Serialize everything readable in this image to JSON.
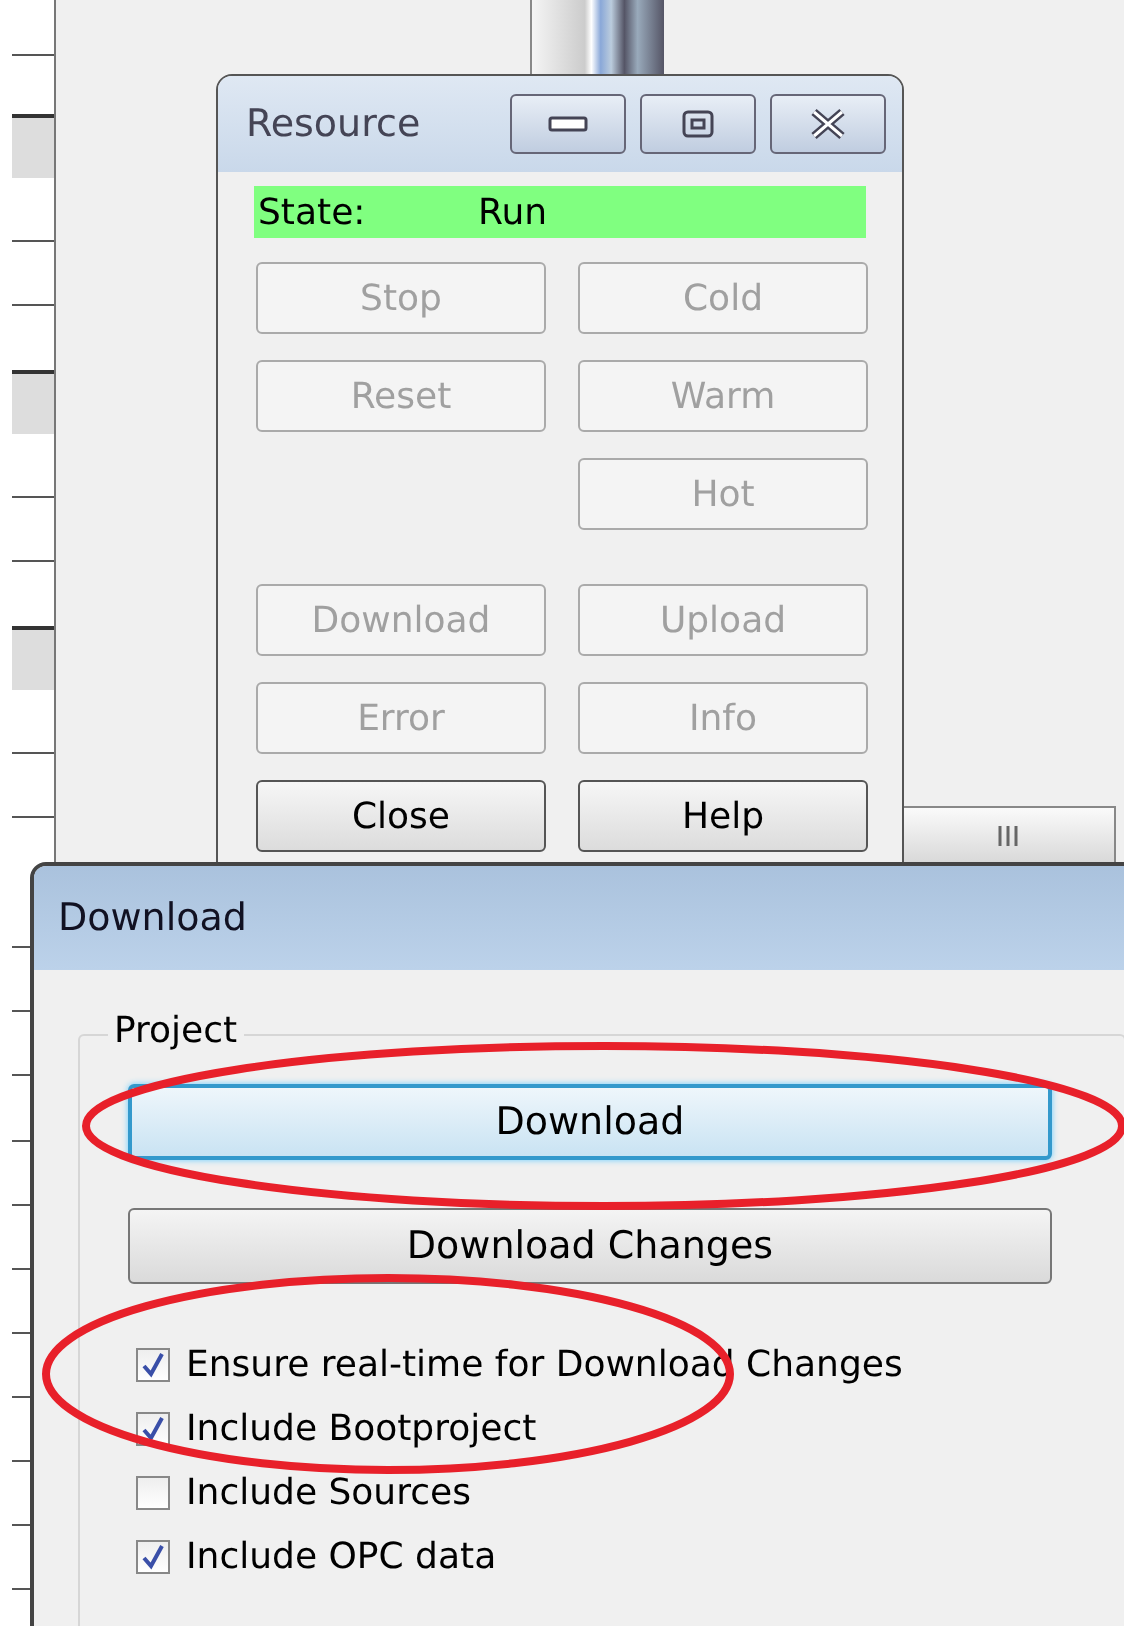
{
  "resource_window": {
    "title": "Resource",
    "state": {
      "label": "State:",
      "value": "Run"
    },
    "button_groups": [
      [
        {
          "left": {
            "label": "Stop",
            "disabled": true
          },
          "right": {
            "label": "Cold",
            "disabled": true
          }
        },
        {
          "left": {
            "label": "Reset",
            "disabled": true
          },
          "right": {
            "label": "Warm",
            "disabled": true
          }
        },
        {
          "right": {
            "label": "Hot",
            "disabled": true
          }
        }
      ],
      [
        {
          "left": {
            "label": "Download",
            "disabled": true
          },
          "right": {
            "label": "Upload",
            "disabled": true
          }
        },
        {
          "left": {
            "label": "Error",
            "disabled": true
          },
          "right": {
            "label": "Info",
            "disabled": true
          }
        },
        {
          "left": {
            "label": "Close",
            "disabled": false
          },
          "right": {
            "label": "Help",
            "disabled": false
          }
        }
      ]
    ]
  },
  "download_dialog": {
    "title": "Download",
    "group": {
      "label": "Project",
      "buttons": [
        {
          "label": "Download",
          "default": true
        },
        {
          "label": "Download Changes",
          "default": false
        }
      ],
      "options": [
        {
          "label": "Ensure real-time for Download Changes",
          "checked": true
        },
        {
          "label": "Include Bootproject",
          "checked": true
        },
        {
          "label": "Include Sources",
          "checked": false
        },
        {
          "label": "Include OPC data",
          "checked": true
        }
      ]
    }
  }
}
